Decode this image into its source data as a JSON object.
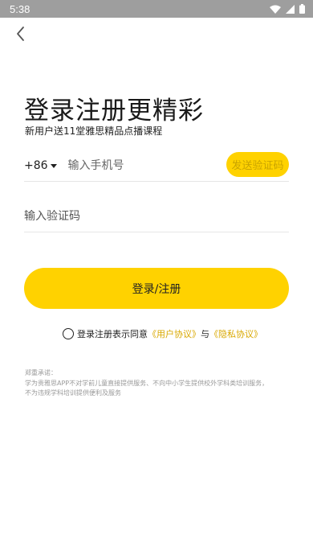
{
  "status_bar": {
    "time": "5:38",
    "icons": [
      "wifi-icon",
      "signal-icon",
      "battery-icon"
    ]
  },
  "nav": {
    "back_icon": "back-chevron-icon"
  },
  "header": {
    "title": "登录注册更精彩",
    "subtitle": "新用户送11堂雅思精品点播课程"
  },
  "phone": {
    "country_code": "+86",
    "placeholder": "输入手机号",
    "send_code_label": "发送验证码"
  },
  "code": {
    "placeholder": "输入验证码"
  },
  "login_button": "登录/注册",
  "agreement": {
    "prefix": "登录注册表示同意",
    "user_agreement": "《用户协议》",
    "and": "与",
    "privacy_policy": "《隐私协议》"
  },
  "disclaimer": {
    "heading": "郑重承诺：",
    "line1": "学为贵雅思APP不对学前儿童直接提供服务、不向中小学生提供校外学科类培训服务，",
    "line2": "不为违规学科培训提供便利及服务"
  },
  "colors": {
    "accent": "#ffd200",
    "link": "#d9a800",
    "status_bar": "#9e9e9e"
  }
}
